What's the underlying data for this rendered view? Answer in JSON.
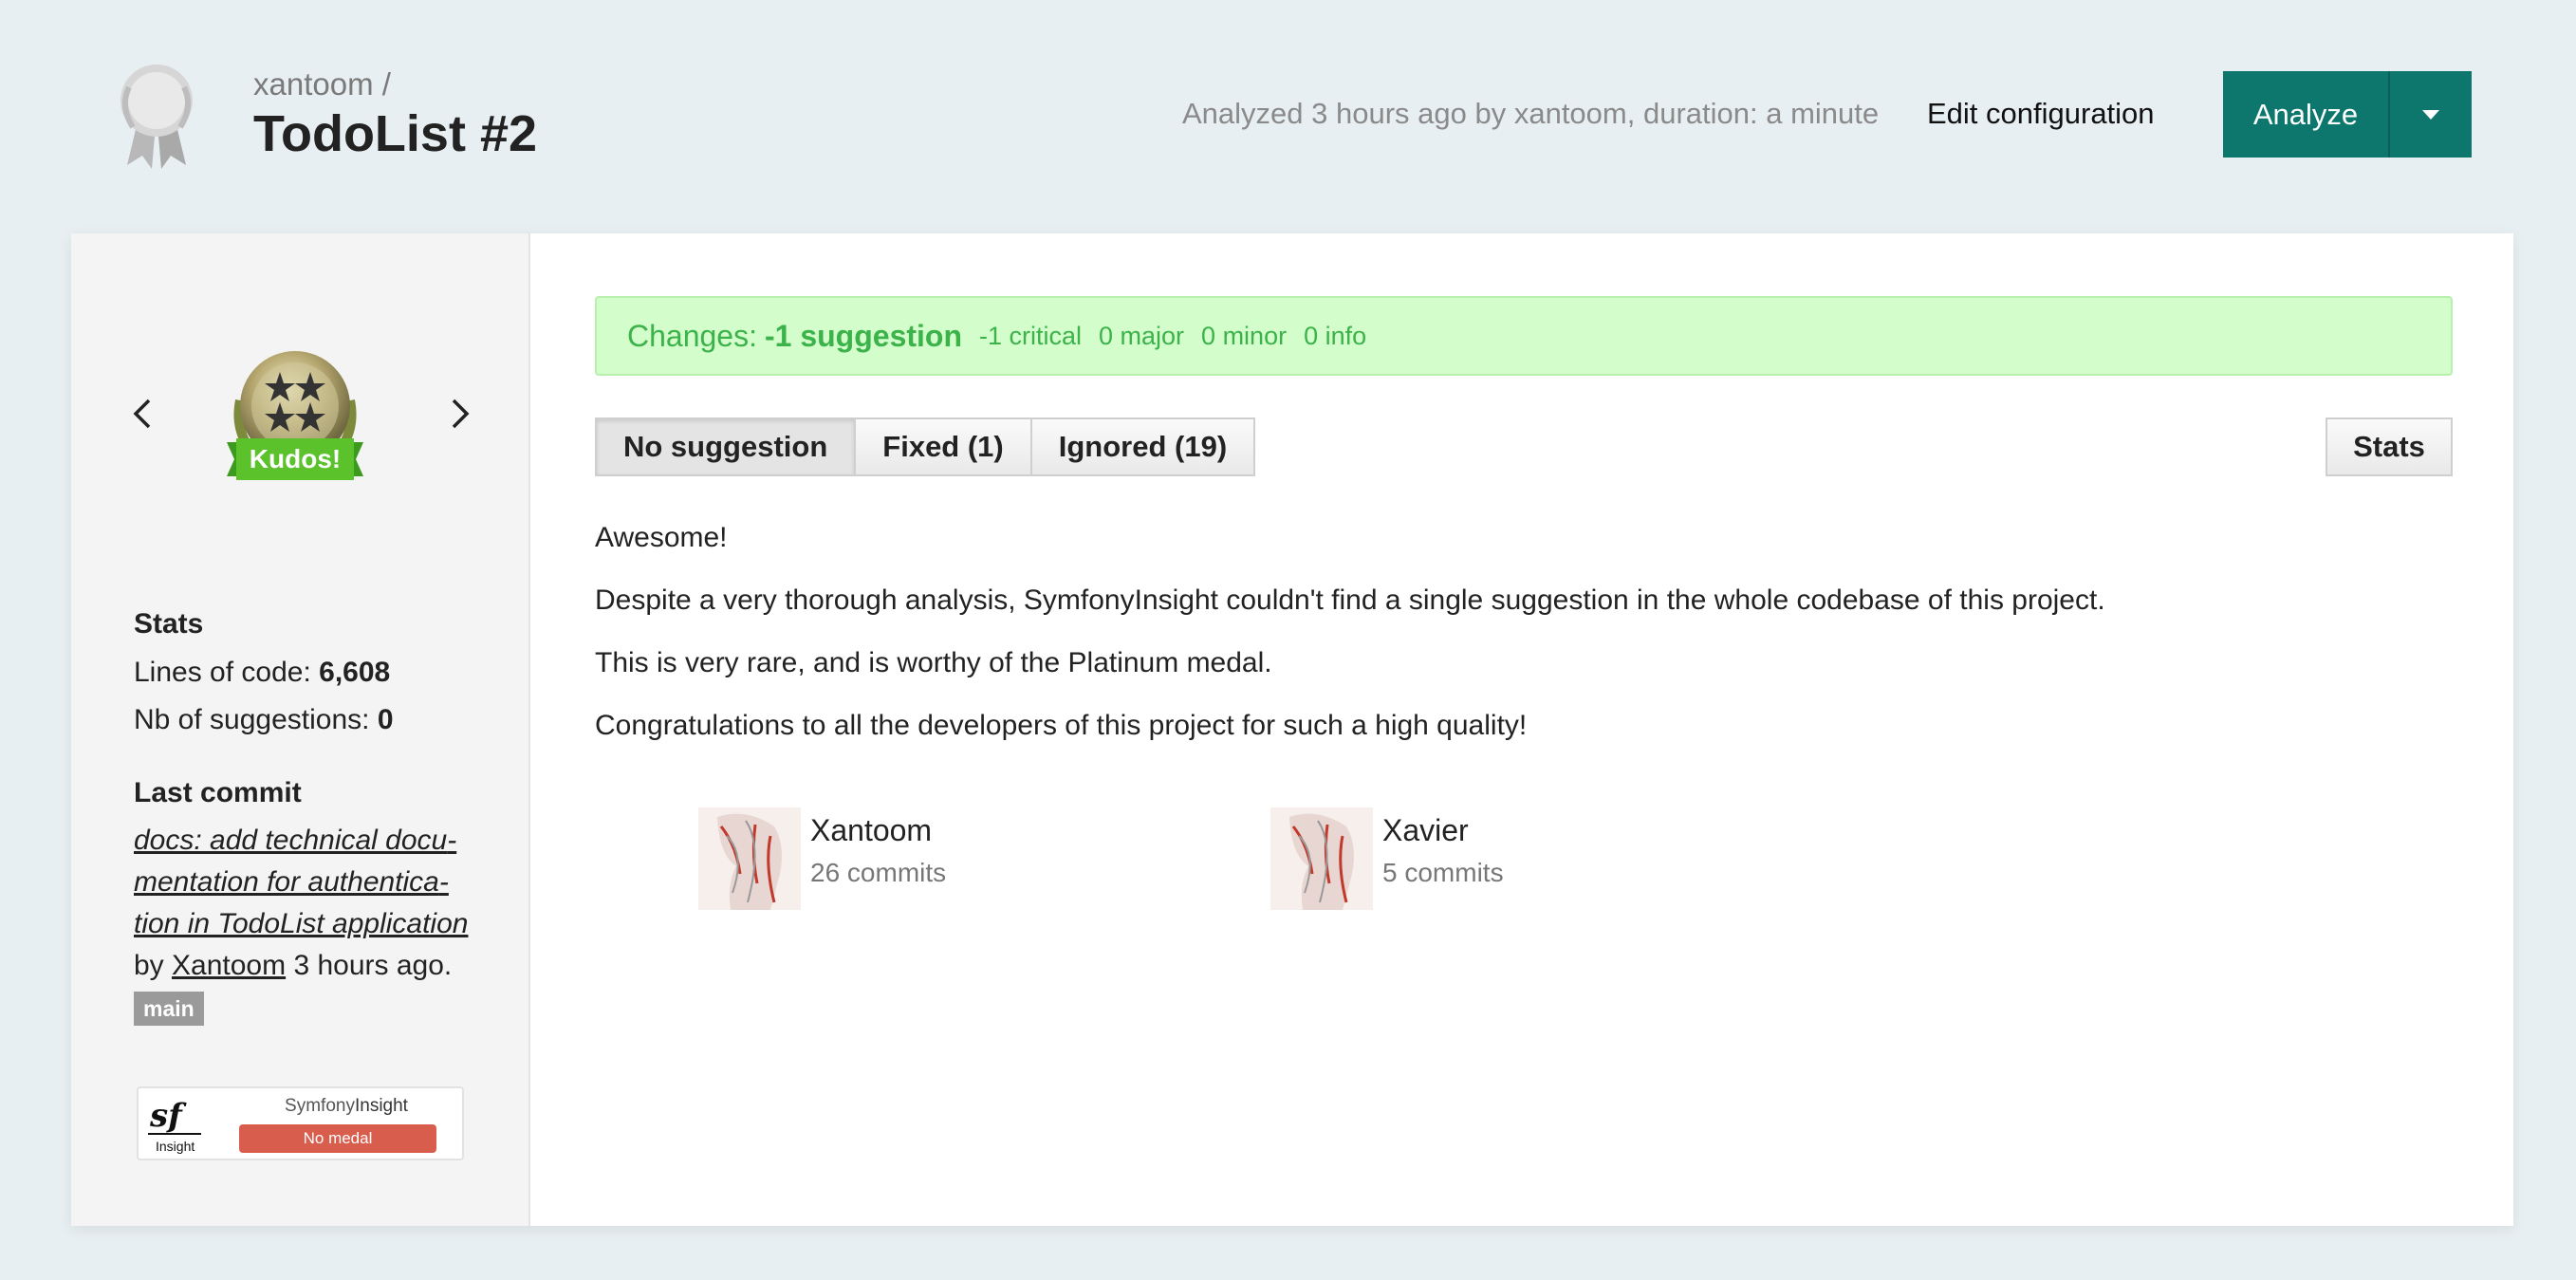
{
  "header": {
    "owner": "xantoom /",
    "project_title": "TodoList #2",
    "analyzed_text": "Analyzed 3 hours ago by xantoom, duration: a minute",
    "edit_config_label": "Edit configuration",
    "analyze_label": "Analyze",
    "logo_icon": "platinum-medal-icon"
  },
  "sidebar": {
    "medal_badge_text": "Kudos!",
    "stats_heading": "Stats",
    "lines_of_code_label": "Lines of code:",
    "lines_of_code_value": "6,608",
    "suggestions_label": "Nb of suggestions:",
    "suggestions_value": "0",
    "last_commit_heading": "Last commit",
    "commit_message": "docs: add technical docu­mentation for authentica­tion in TodoList applica­tion",
    "commit_by": "by",
    "commit_author": "Xantoom",
    "commit_time": "3 hours ago.",
    "branch": "main",
    "insight_badge": {
      "brand_light": "Symfony",
      "brand_bold": "Insight",
      "sf_sublabel": "Insight",
      "status": "No medal"
    }
  },
  "content": {
    "changes": {
      "label": "Changes:",
      "value": "-1 suggestion",
      "critical": "-1 critical",
      "major": "0 major",
      "minor": "0 minor",
      "info": "0 info"
    },
    "tabs": [
      {
        "label": "No suggestion",
        "active": true
      },
      {
        "label": "Fixed (1)",
        "active": false
      },
      {
        "label": "Ignored (19)",
        "active": false
      }
    ],
    "stats_button": "Stats",
    "paragraphs": [
      "Awesome!",
      "Despite a very thorough analysis, SymfonyInsight couldn't find a single suggestion in the whole codebase of this project.",
      "This is very rare, and is worthy of the Platinum medal.",
      "Congratulations to all the developers of this project for such a high quality!"
    ],
    "contributors": [
      {
        "name": "Xantoom",
        "commits": "26 commits"
      },
      {
        "name": "Xavier",
        "commits": "5 commits"
      }
    ]
  },
  "colors": {
    "accent": "#0d776e",
    "changes_bg": "#d4fdcc",
    "changes_text": "#3bb34a",
    "no_medal": "#d95d4c",
    "page_bg": "#e8eff2"
  }
}
